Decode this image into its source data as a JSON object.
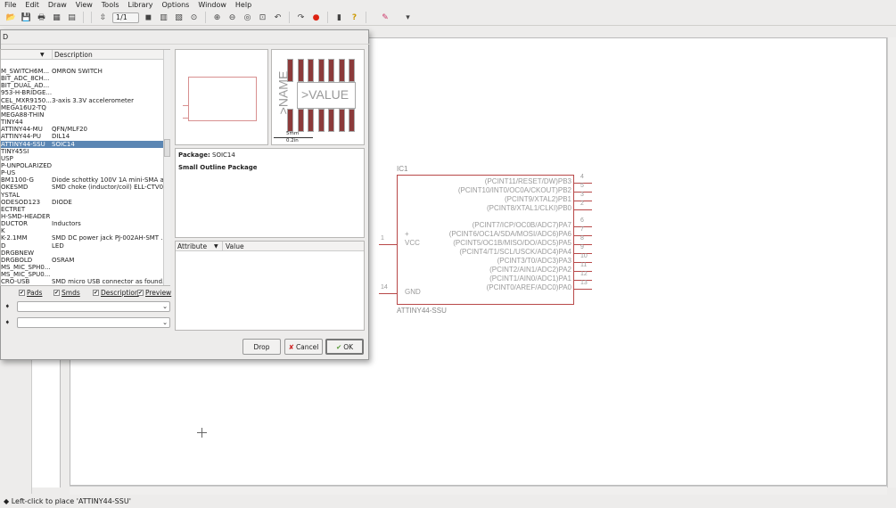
{
  "menu": [
    "File",
    "Edit",
    "Draw",
    "View",
    "Tools",
    "Library",
    "Options",
    "Window",
    "Help"
  ],
  "toolbar": {
    "page": "1/1",
    "icons": [
      "open-icon",
      "save-icon",
      "print-icon",
      "cam-icon",
      "board-icon",
      "page-icon",
      "use-library-icon",
      "script-icon",
      "run-icon",
      "zoom-fit-icon",
      "zoom-in-icon",
      "zoom-out-icon",
      "zoom-redraw-icon",
      "zoom-select-icon",
      "undo-icon",
      "redo-icon",
      "stop-icon",
      "go-icon",
      "help-icon",
      "design-link-icon"
    ]
  },
  "dialog": {
    "title": "D",
    "list_headers": [
      "",
      "Description"
    ],
    "items": [
      [
        "M_SWITCH6M...",
        "OMRON SWITCH"
      ],
      [
        "BIT_ADC_8CH...",
        ""
      ],
      [
        "BIT_DUAL_AD...",
        ""
      ],
      [
        "953-H-BRIDGE...",
        ""
      ],
      [
        "CEL_MXR9150...",
        "3-axis 3.3V accelerometer"
      ],
      [
        "MEGA16U2-TQ",
        ""
      ],
      [
        "MEGA88-THIN",
        ""
      ],
      [
        "TINY44",
        ""
      ],
      [
        "ATTINY44-MU",
        "QFN/MLF20"
      ],
      [
        "ATTINY44-PU",
        "DIL14"
      ],
      [
        "ATTINY44-SSU",
        "SOIC14"
      ],
      [
        "TINY45SI",
        ""
      ],
      [
        "USP",
        ""
      ],
      [
        "P-UNPOLARIZED",
        ""
      ],
      [
        "P-US",
        ""
      ],
      [
        "BM1100-G",
        "Diode schottky 100V 1A mini-SMA a..."
      ],
      [
        "OKESMD",
        "SMD choke (inductor/coil) ELL-CTV0..."
      ],
      [
        "YSTAL",
        ""
      ],
      [
        "ODESOD123",
        "DIODE"
      ],
      [
        "ECTRET",
        ""
      ],
      [
        "H-SMD-HEADER",
        ""
      ],
      [
        "DUCTOR",
        "Inductors"
      ],
      [
        "K",
        ""
      ],
      [
        "K-2.1MM",
        "SMD DC power jack PJ-002AH-SMT ..."
      ],
      [
        "D",
        "LED"
      ],
      [
        "DRGBNEW",
        ""
      ],
      [
        "DRGBOLD",
        "OSRAM"
      ],
      [
        "MS_MIC_SPH0...",
        ""
      ],
      [
        "MS_MIC_SPU0...",
        ""
      ],
      [
        "CRO-USB",
        "SMD micro USB connector as found..."
      ]
    ],
    "selected": "ATTINY44-SSU",
    "checks": [
      {
        "label": "Pads",
        "checked": true
      },
      {
        "label": "Smds",
        "checked": true
      },
      {
        "label": "Description",
        "checked": true
      },
      {
        "label": "Preview",
        "checked": true
      }
    ],
    "package_label": "Package:",
    "package": "SOIC14",
    "package_desc": "Small Outline Package",
    "attr_headers": [
      "Attribute",
      "Value"
    ],
    "preview": {
      "name": ">NAME",
      "value": ">VALUE",
      "scale_mm": "5mm",
      "scale_in": "0.2in"
    },
    "buttons": {
      "drop": "Drop",
      "cancel": "Cancel",
      "ok": "OK"
    }
  },
  "schematic": {
    "ref": "IC1",
    "part": "ATTINY44-SSU",
    "color": "#b84848",
    "right_pins": [
      [
        "(PCINT11/RESET/DW)PB3",
        "4"
      ],
      [
        "(PCINT10/INT0/OC0A/CKOUT)PB2",
        "5"
      ],
      [
        "(PCINT9/XTAL2)PB1",
        "3"
      ],
      [
        "(PCINT8/XTAL1/CLKI)PB0",
        "2"
      ],
      [
        "(PCINT7/ICP/OC0B/ADC7)PA7",
        "6"
      ],
      [
        "(PCINT6/OC1A/SDA/MOSI/ADC6)PA6",
        "7"
      ],
      [
        "(PCINT5/OC1B/MISO/DO/ADC5)PA5",
        "8"
      ],
      [
        "(PCINT4/T1/SCL/USCK/ADC4)PA4",
        "9"
      ],
      [
        "(PCINT3/T0/ADC3)PA3",
        "10"
      ],
      [
        "(PCINT2/AIN1/ADC2)PA2",
        "11"
      ],
      [
        "(PCINT1/AIN0/ADC1)PA1",
        "12"
      ],
      [
        "(PCINT0/AREF/ADC0)PA0",
        "13"
      ]
    ],
    "left_pins": [
      [
        "VCC",
        "1",
        "+"
      ],
      [
        "GND",
        "14",
        ""
      ]
    ]
  },
  "status": "Left-click to place 'ATTINY44-SSU'"
}
